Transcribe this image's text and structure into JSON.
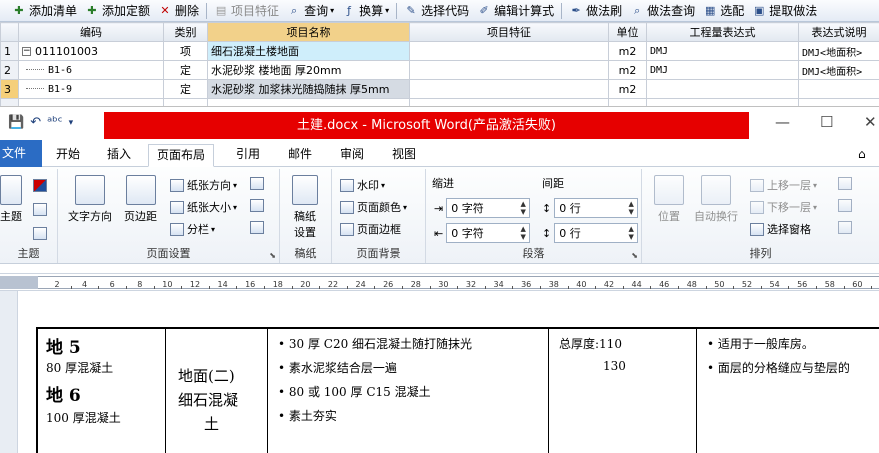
{
  "toolbar": {
    "items": [
      {
        "label": "添加清单",
        "icon": "add-list-icon",
        "color": "#2a7d2a"
      },
      {
        "label": "添加定额",
        "icon": "add-quota-icon",
        "color": "#2a7d2a"
      },
      {
        "label": "删除",
        "icon": "delete-icon",
        "color": "#c00000"
      },
      {
        "label": "项目特征",
        "icon": "feature-icon",
        "disabled": true
      },
      {
        "label": "查询",
        "icon": "search-icon",
        "arrow": true
      },
      {
        "label": "换算",
        "icon": "convert-icon",
        "arrow": true
      },
      {
        "label": "选择代码",
        "icon": "select-code-icon"
      },
      {
        "label": "编辑计算式",
        "icon": "edit-formula-icon"
      },
      {
        "label": "做法刷",
        "icon": "method-brush-icon"
      },
      {
        "label": "做法查询",
        "icon": "method-query-icon"
      },
      {
        "label": "选配",
        "icon": "match-icon"
      },
      {
        "label": "提取做法",
        "icon": "extract-method-icon"
      }
    ]
  },
  "grid": {
    "headers": [
      "",
      "编码",
      "类别",
      "项目名称",
      "项目特征",
      "单位",
      "工程量表达式",
      "表达式说明"
    ],
    "rows": [
      {
        "num": "1",
        "code": "011101003",
        "type": "项",
        "name": "细石混凝土楼地面",
        "feature": "",
        "unit": "m2",
        "expr": "DMJ",
        "desc": "DMJ<地面积>"
      },
      {
        "num": "2",
        "code": "B1-6",
        "type": "定",
        "name": "水泥砂浆 楼地面 厚20mm",
        "feature": "",
        "unit": "m2",
        "expr": "DMJ",
        "desc": "DMJ<地面积>"
      },
      {
        "num": "3",
        "code": "B1-9",
        "type": "定",
        "name": "水泥砂浆 加浆抹光随捣随抹 厚5mm",
        "feature": "",
        "unit": "m2",
        "expr": "",
        "desc": ""
      }
    ]
  },
  "word": {
    "title": "土建.docx - Microsoft Word(产品激活失败)",
    "tabs": [
      "文件",
      "开始",
      "插入",
      "页面布局",
      "引用",
      "邮件",
      "审阅",
      "视图"
    ],
    "active_tab": "页面布局",
    "ribbon": {
      "theme_group": "主题",
      "theme_btn": "主题",
      "page_setup_group": "页面设置",
      "text_direction": "文字方向",
      "margins": "页边距",
      "orientation": "纸张方向",
      "size": "纸张大小",
      "columns": "分栏",
      "draft_group": "稿纸",
      "draft_btn1": "稿纸",
      "draft_btn2": "设置",
      "bg_group": "页面背景",
      "watermark": "水印",
      "page_color": "页面颜色",
      "page_border": "页面边框",
      "para_group": "段落",
      "indent": "缩进",
      "spacing": "间距",
      "indent_left": "0 字符",
      "indent_right": "0 字符",
      "space_before": "0 行",
      "space_after": "0 行",
      "arrange_group": "排列",
      "position": "位置",
      "wrap": "自动换行",
      "bring_forward": "上移一层",
      "send_backward": "下移一层",
      "selection_pane": "选择窗格"
    },
    "ruler_labels": [
      "2",
      "4",
      "6",
      "8",
      "10",
      "12",
      "14",
      "16",
      "18",
      "20",
      "22",
      "24",
      "26",
      "28",
      "30",
      "32",
      "34",
      "36",
      "38",
      "40",
      "42",
      "44",
      "46",
      "48",
      "50",
      "52",
      "54",
      "56",
      "58",
      "60"
    ],
    "doc": {
      "col1_lines": [
        "地 5",
        "80 厚混凝土",
        "地 6",
        "100 厚混凝土"
      ],
      "col2_lines": [
        "地面(二)",
        "细石混凝",
        "土"
      ],
      "col3_lines": [
        "• 30 厚 C20 细石混凝土随打随抹光",
        "• 素水泥浆结合层一遍",
        "• 80 或 100 厚 C15 混凝土",
        "• 素土夯实"
      ],
      "col4_lines": [
        "总厚度:110",
        "130"
      ],
      "col5_lines": [
        "• 适用于一般库房。",
        "• 面层的分格缝应与垫层的"
      ]
    }
  }
}
